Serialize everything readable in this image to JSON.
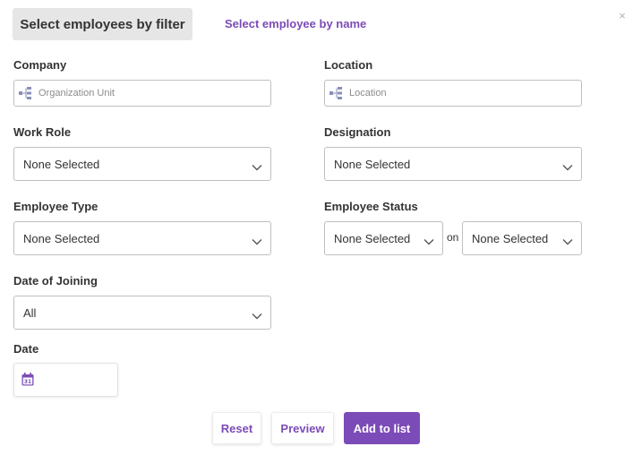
{
  "tabs": {
    "filter_label": "Select employees by filter",
    "name_label": "Select employee by name"
  },
  "close_glyph": "×",
  "fields": {
    "company": {
      "label": "Company",
      "placeholder": "Organization Unit"
    },
    "location": {
      "label": "Location",
      "placeholder": "Location"
    },
    "work_role": {
      "label": "Work Role",
      "value": "None Selected"
    },
    "designation": {
      "label": "Designation",
      "value": "None Selected"
    },
    "employee_type": {
      "label": "Employee Type",
      "value": "None Selected"
    },
    "employee_status": {
      "label": "Employee Status",
      "value": "None Selected",
      "on_text": "on",
      "on_value": "None Selected"
    },
    "date_of_joining": {
      "label": "Date of Joining",
      "value": "All"
    },
    "date": {
      "label": "Date",
      "calendar_day": "31"
    }
  },
  "buttons": {
    "reset": "Reset",
    "preview": "Preview",
    "add": "Add to list"
  },
  "colors": {
    "accent": "#7b4bb7",
    "tab_bg": "#e6e6e6",
    "border": "#bfbfbf"
  },
  "icons": {
    "company": "org-tree-icon",
    "location": "org-tree-icon",
    "select": "chevron-down-icon",
    "date": "calendar-icon",
    "close": "close-icon"
  }
}
